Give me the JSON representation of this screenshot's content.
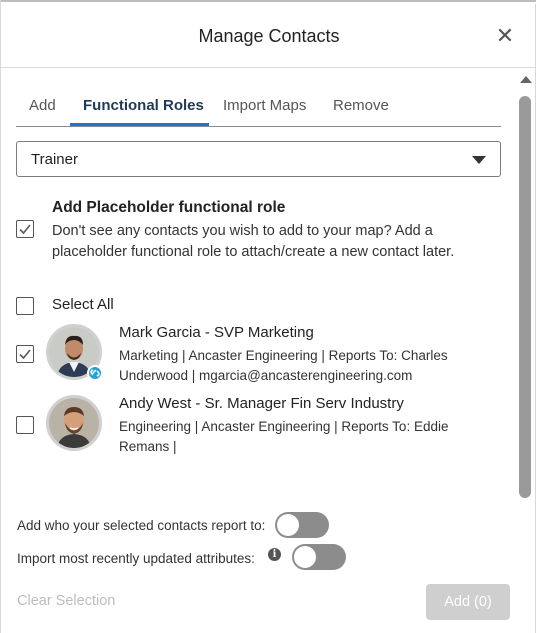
{
  "header": {
    "title": "Manage Contacts",
    "close_glyph": "✕"
  },
  "tabs": [
    {
      "label": "Add",
      "active": false
    },
    {
      "label": "Functional Roles",
      "active": true
    },
    {
      "label": "Import Maps",
      "active": false
    },
    {
      "label": "Remove",
      "active": false
    }
  ],
  "role_select": {
    "value": "Trainer"
  },
  "placeholder": {
    "checked": true,
    "title": "Add Placeholder functional role",
    "description": "Don't see any contacts you wish to add to your map? Add a placeholder functional role to attach/create a new contact later."
  },
  "select_all": {
    "label": "Select All",
    "checked": false
  },
  "contacts": [
    {
      "checked": true,
      "name_line": "Mark Garcia  - SVP Marketing",
      "details": "Marketing | Ancaster Engineering | Reports To: Charles Underwood | mgarcia@ancasterengineering.com",
      "has_badge": true
    },
    {
      "checked": false,
      "name_line": "Andy West  - Sr. Manager Fin Serv Industry",
      "details": "Engineering | Ancaster Engineering | Reports To: Eddie Remans |",
      "has_badge": false
    }
  ],
  "options": {
    "report_to_label": "Add who your selected contacts report to:",
    "report_to_on": false,
    "import_attr_label": "Import most recently updated attributes:",
    "import_attr_on": false,
    "info_glyph": "i"
  },
  "footer": {
    "clear_label": "Clear Selection",
    "add_label": "Add (0)"
  },
  "colors": {
    "accent": "#1b77d2",
    "active_tab_text": "#1f3b57",
    "toggle_off": "#8c8c8c",
    "disabled_button": "#cfcfcf"
  }
}
